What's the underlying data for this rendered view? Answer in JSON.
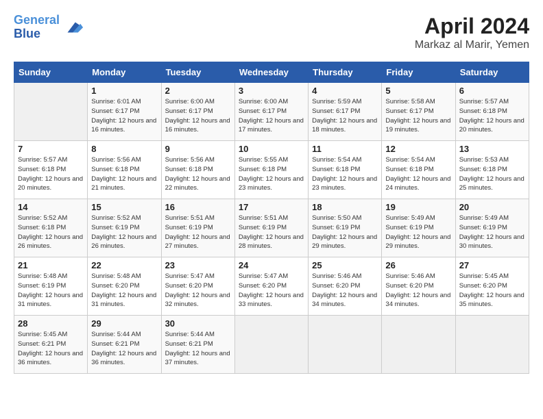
{
  "header": {
    "logo_line1": "General",
    "logo_line2": "Blue",
    "month_year": "April 2024",
    "location": "Markaz al Marir, Yemen"
  },
  "weekdays": [
    "Sunday",
    "Monday",
    "Tuesday",
    "Wednesday",
    "Thursday",
    "Friday",
    "Saturday"
  ],
  "weeks": [
    [
      {
        "day": "",
        "empty": true
      },
      {
        "day": "1",
        "sunrise": "6:01 AM",
        "sunset": "6:17 PM",
        "daylight": "12 hours and 16 minutes."
      },
      {
        "day": "2",
        "sunrise": "6:00 AM",
        "sunset": "6:17 PM",
        "daylight": "12 hours and 16 minutes."
      },
      {
        "day": "3",
        "sunrise": "6:00 AM",
        "sunset": "6:17 PM",
        "daylight": "12 hours and 17 minutes."
      },
      {
        "day": "4",
        "sunrise": "5:59 AM",
        "sunset": "6:17 PM",
        "daylight": "12 hours and 18 minutes."
      },
      {
        "day": "5",
        "sunrise": "5:58 AM",
        "sunset": "6:17 PM",
        "daylight": "12 hours and 19 minutes."
      },
      {
        "day": "6",
        "sunrise": "5:57 AM",
        "sunset": "6:18 PM",
        "daylight": "12 hours and 20 minutes."
      }
    ],
    [
      {
        "day": "7",
        "sunrise": "5:57 AM",
        "sunset": "6:18 PM",
        "daylight": "12 hours and 20 minutes."
      },
      {
        "day": "8",
        "sunrise": "5:56 AM",
        "sunset": "6:18 PM",
        "daylight": "12 hours and 21 minutes."
      },
      {
        "day": "9",
        "sunrise": "5:56 AM",
        "sunset": "6:18 PM",
        "daylight": "12 hours and 22 minutes."
      },
      {
        "day": "10",
        "sunrise": "5:55 AM",
        "sunset": "6:18 PM",
        "daylight": "12 hours and 23 minutes."
      },
      {
        "day": "11",
        "sunrise": "5:54 AM",
        "sunset": "6:18 PM",
        "daylight": "12 hours and 23 minutes."
      },
      {
        "day": "12",
        "sunrise": "5:54 AM",
        "sunset": "6:18 PM",
        "daylight": "12 hours and 24 minutes."
      },
      {
        "day": "13",
        "sunrise": "5:53 AM",
        "sunset": "6:18 PM",
        "daylight": "12 hours and 25 minutes."
      }
    ],
    [
      {
        "day": "14",
        "sunrise": "5:52 AM",
        "sunset": "6:18 PM",
        "daylight": "12 hours and 26 minutes."
      },
      {
        "day": "15",
        "sunrise": "5:52 AM",
        "sunset": "6:19 PM",
        "daylight": "12 hours and 26 minutes."
      },
      {
        "day": "16",
        "sunrise": "5:51 AM",
        "sunset": "6:19 PM",
        "daylight": "12 hours and 27 minutes."
      },
      {
        "day": "17",
        "sunrise": "5:51 AM",
        "sunset": "6:19 PM",
        "daylight": "12 hours and 28 minutes."
      },
      {
        "day": "18",
        "sunrise": "5:50 AM",
        "sunset": "6:19 PM",
        "daylight": "12 hours and 29 minutes."
      },
      {
        "day": "19",
        "sunrise": "5:49 AM",
        "sunset": "6:19 PM",
        "daylight": "12 hours and 29 minutes."
      },
      {
        "day": "20",
        "sunrise": "5:49 AM",
        "sunset": "6:19 PM",
        "daylight": "12 hours and 30 minutes."
      }
    ],
    [
      {
        "day": "21",
        "sunrise": "5:48 AM",
        "sunset": "6:19 PM",
        "daylight": "12 hours and 31 minutes."
      },
      {
        "day": "22",
        "sunrise": "5:48 AM",
        "sunset": "6:20 PM",
        "daylight": "12 hours and 31 minutes."
      },
      {
        "day": "23",
        "sunrise": "5:47 AM",
        "sunset": "6:20 PM",
        "daylight": "12 hours and 32 minutes."
      },
      {
        "day": "24",
        "sunrise": "5:47 AM",
        "sunset": "6:20 PM",
        "daylight": "12 hours and 33 minutes."
      },
      {
        "day": "25",
        "sunrise": "5:46 AM",
        "sunset": "6:20 PM",
        "daylight": "12 hours and 34 minutes."
      },
      {
        "day": "26",
        "sunrise": "5:46 AM",
        "sunset": "6:20 PM",
        "daylight": "12 hours and 34 minutes."
      },
      {
        "day": "27",
        "sunrise": "5:45 AM",
        "sunset": "6:20 PM",
        "daylight": "12 hours and 35 minutes."
      }
    ],
    [
      {
        "day": "28",
        "sunrise": "5:45 AM",
        "sunset": "6:21 PM",
        "daylight": "12 hours and 36 minutes."
      },
      {
        "day": "29",
        "sunrise": "5:44 AM",
        "sunset": "6:21 PM",
        "daylight": "12 hours and 36 minutes."
      },
      {
        "day": "30",
        "sunrise": "5:44 AM",
        "sunset": "6:21 PM",
        "daylight": "12 hours and 37 minutes."
      },
      {
        "day": "",
        "empty": true
      },
      {
        "day": "",
        "empty": true
      },
      {
        "day": "",
        "empty": true
      },
      {
        "day": "",
        "empty": true
      }
    ]
  ],
  "labels": {
    "sunrise": "Sunrise:",
    "sunset": "Sunset:",
    "daylight": "Daylight:"
  }
}
